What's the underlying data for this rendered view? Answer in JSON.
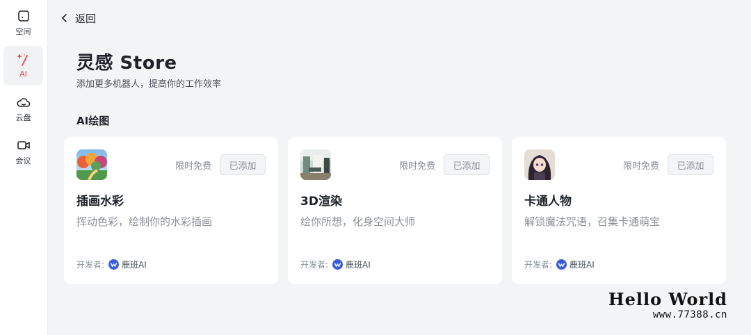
{
  "sidebar": {
    "items": [
      {
        "label": "空间",
        "icon": "space-icon",
        "active": false
      },
      {
        "label": "AI",
        "icon": "magic-wand-icon",
        "active": true
      },
      {
        "label": "云盘",
        "icon": "cloud-icon",
        "active": false
      },
      {
        "label": "会议",
        "icon": "video-camera-icon",
        "active": false
      }
    ],
    "accent_color": "#e5484d"
  },
  "header": {
    "back_label": "返回"
  },
  "page": {
    "title": "灵感 Store",
    "subtitle": "添加更多机器人，提高你的工作效率",
    "section_title": "AI绘图"
  },
  "cards": [
    {
      "name": "插画水彩",
      "description": "挥动色彩，绘制你的水彩插画",
      "price_tag": "限时免费",
      "button_label": "已添加",
      "developer_label": "开发者:",
      "developer_name": "鹿班AI"
    },
    {
      "name": "3D渲染",
      "description": "绘你所想，化身空间大师",
      "price_tag": "限时免费",
      "button_label": "已添加",
      "developer_label": "开发者:",
      "developer_name": "鹿班AI"
    },
    {
      "name": "卡通人物",
      "description": "解锁魔法咒语，召集卡通萌宝",
      "price_tag": "限时免费",
      "button_label": "已添加",
      "developer_label": "开发者:",
      "developer_name": "鹿班AI"
    }
  ],
  "watermark": {
    "title": "Hello World",
    "url": "www.77388.cn"
  }
}
